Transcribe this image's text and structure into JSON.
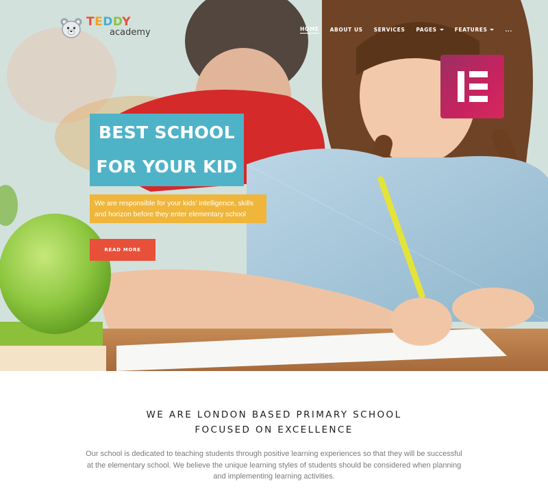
{
  "brand": {
    "logo_letters": [
      "T",
      "E",
      "D",
      "D",
      "Y"
    ],
    "logo_sub": "academy",
    "logo_icon": "bear-icon",
    "colors": {
      "red": "#e8503a",
      "orange": "#f2a31d",
      "blue": "#4aaed1",
      "green": "#8bc34a"
    }
  },
  "nav": {
    "items": [
      {
        "label": "HOME",
        "active": true,
        "dropdown": false
      },
      {
        "label": "ABOUT US",
        "active": false,
        "dropdown": false
      },
      {
        "label": "SERVICES",
        "active": false,
        "dropdown": false
      },
      {
        "label": "PAGES",
        "active": false,
        "dropdown": true
      },
      {
        "label": "FEATURES",
        "active": false,
        "dropdown": true
      },
      {
        "label": "...",
        "active": false,
        "dropdown": false
      }
    ]
  },
  "badge": {
    "icon": "elementor-icon",
    "color": "#c7235f"
  },
  "hero": {
    "headline_lines": [
      "BEST SCHOOL",
      "FOR YOUR KID"
    ],
    "subtext_lines": [
      "We are responsible for your kids' intelligence, skills",
      "and horizon before they enter elementary school"
    ],
    "cta_label": "READ MORE",
    "colors": {
      "headline_bg": "#4fb3c8",
      "subtext_bg": "#efb63b",
      "cta_bg": "#e8503a"
    }
  },
  "intro": {
    "title_lines": [
      "WE ARE LONDON BASED PRIMARY SCHOOL",
      "FOCUSED ON EXCELLENCE"
    ],
    "body_lines": [
      "Our school is dedicated to teaching students through positive learning experiences so that they will be successful",
      "at the elementary school. We believe the unique learning styles of students should be considered when planning",
      "and implementing learning activities."
    ]
  }
}
